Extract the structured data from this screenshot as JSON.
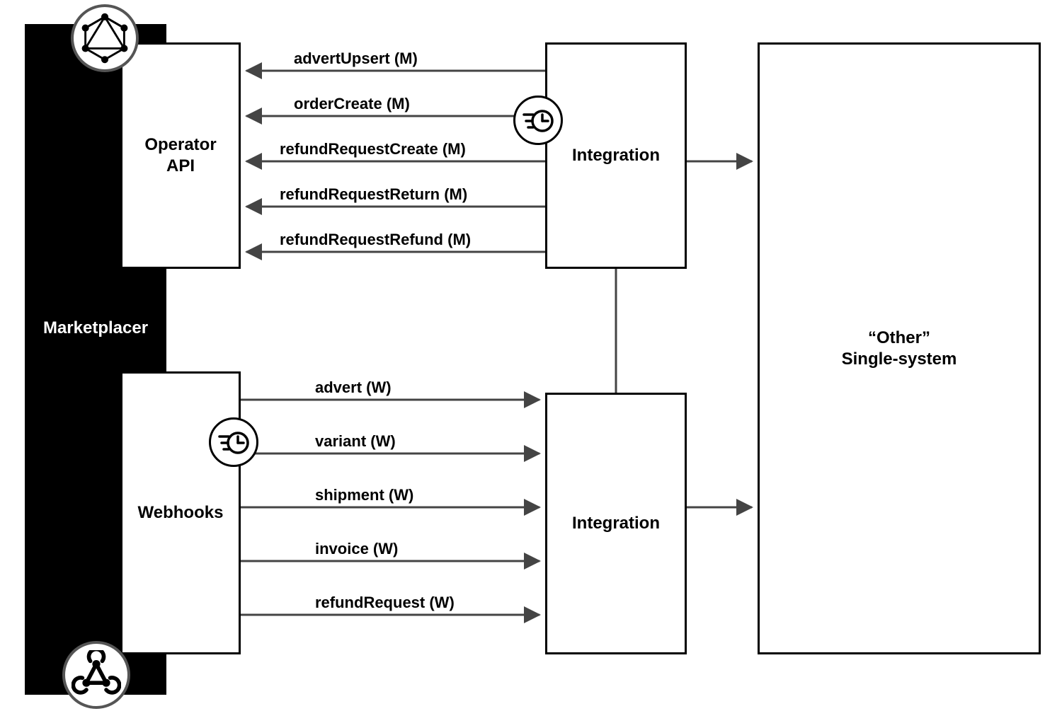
{
  "marketplacer": {
    "label": "Marketplacer"
  },
  "operator_api": {
    "label_line1": "Operator",
    "label_line2": "API"
  },
  "webhooks": {
    "label": "Webhooks"
  },
  "integration1": {
    "label": "Integration"
  },
  "integration2": {
    "label": "Integration"
  },
  "other_system": {
    "label_line1": "“Other”",
    "label_line2": "Single-system"
  },
  "mutations": [
    {
      "label": "advertUpsert (M)"
    },
    {
      "label": "orderCreate (M)"
    },
    {
      "label": "refundRequestCreate (M)"
    },
    {
      "label": "refundRequestReturn (M)"
    },
    {
      "label": "refundRequestRefund (M)"
    }
  ],
  "webhook_events": [
    {
      "label": "advert (W)"
    },
    {
      "label": "variant (W)"
    },
    {
      "label": "shipment (W)"
    },
    {
      "label": "invoice (W)"
    },
    {
      "label": "refundRequest (W)"
    }
  ],
  "chart_data": {
    "type": "table",
    "description": "Integration architecture between Marketplacer and an external single-system via an Integration layer.",
    "nodes": [
      {
        "id": "marketplacer",
        "label": "Marketplacer"
      },
      {
        "id": "operator_api",
        "label": "Operator API",
        "parent": "marketplacer",
        "badge": "graphql-icon"
      },
      {
        "id": "webhooks",
        "label": "Webhooks",
        "parent": "marketplacer",
        "badge": "webhook-icon"
      },
      {
        "id": "integration1",
        "label": "Integration",
        "badge": "scheduled-icon"
      },
      {
        "id": "integration2",
        "label": "Integration"
      },
      {
        "id": "other_system",
        "label": "\"Other\" Single-system"
      }
    ],
    "edges": [
      {
        "from": "integration1",
        "to": "operator_api",
        "label": "advertUpsert (M)",
        "kind": "mutation"
      },
      {
        "from": "integration1",
        "to": "operator_api",
        "label": "orderCreate (M)",
        "kind": "mutation"
      },
      {
        "from": "integration1",
        "to": "operator_api",
        "label": "refundRequestCreate (M)",
        "kind": "mutation"
      },
      {
        "from": "integration1",
        "to": "operator_api",
        "label": "refundRequestReturn (M)",
        "kind": "mutation"
      },
      {
        "from": "integration1",
        "to": "operator_api",
        "label": "refundRequestRefund (M)",
        "kind": "mutation"
      },
      {
        "from": "webhooks",
        "to": "integration2",
        "label": "advert (W)",
        "kind": "webhook",
        "badge_on_source": "scheduled-icon"
      },
      {
        "from": "webhooks",
        "to": "integration2",
        "label": "variant (W)",
        "kind": "webhook"
      },
      {
        "from": "webhooks",
        "to": "integration2",
        "label": "shipment (W)",
        "kind": "webhook"
      },
      {
        "from": "webhooks",
        "to": "integration2",
        "label": "invoice (W)",
        "kind": "webhook"
      },
      {
        "from": "webhooks",
        "to": "integration2",
        "label": "refundRequest (W)",
        "kind": "webhook"
      },
      {
        "from": "integration1",
        "to": "other_system"
      },
      {
        "from": "integration2",
        "to": "other_system"
      },
      {
        "from": "integration1",
        "to": "integration2",
        "style": "connector"
      }
    ]
  }
}
